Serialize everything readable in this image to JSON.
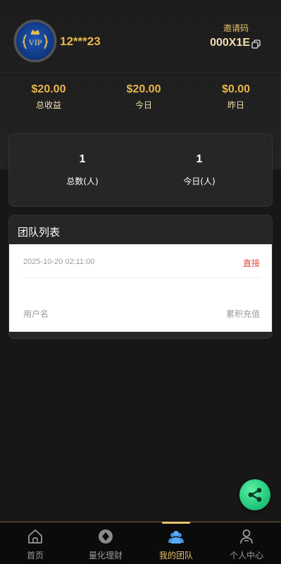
{
  "user": {
    "name": "12***23",
    "avatar_badge": "VIP"
  },
  "invite": {
    "label": "邀请码",
    "code": "000X1E"
  },
  "earnings": [
    {
      "value": "$20.00",
      "label": "总收益"
    },
    {
      "value": "$20.00",
      "label": "今日"
    },
    {
      "value": "$0.00",
      "label": "昨日"
    }
  ],
  "team_stats": [
    {
      "value": "1",
      "label": "总数(人)"
    },
    {
      "value": "1",
      "label": "今日(人)"
    }
  ],
  "team_list": {
    "title": "团队列表",
    "items": [
      {
        "date": "2025-10-20 02:11:00",
        "tag": "直接",
        "col1_label": "用户名",
        "col2_label": "累积充值"
      }
    ]
  },
  "tabs": [
    {
      "label": "首页",
      "icon": "home-icon",
      "active": false
    },
    {
      "label": "量化理财",
      "icon": "coin-icon",
      "active": false
    },
    {
      "label": "我的团队",
      "icon": "team-icon",
      "active": true
    },
    {
      "label": "个人中心",
      "icon": "user-icon",
      "active": false
    }
  ],
  "colors": {
    "accent": "#e8b64a",
    "tag_red": "#e0483f",
    "fab": "#22c97a",
    "active_tab": "#e8c16a"
  }
}
